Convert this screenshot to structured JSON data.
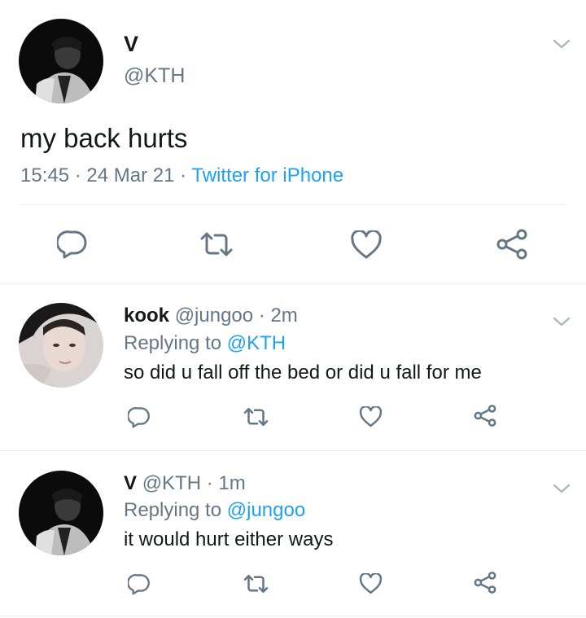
{
  "main_tweet": {
    "name": "V",
    "handle": "@KTH",
    "text": "my back hurts",
    "time": "15:45",
    "sep1": " · ",
    "date": "24 Mar 21",
    "sep2": " · ",
    "source": "Twitter for iPhone"
  },
  "replies": [
    {
      "name": "kook",
      "handle": "@jungoo",
      "time": "· 2m",
      "replying_prefix": "Replying to ",
      "replying_to": "@KTH",
      "text": "so did u fall off the bed or did u fall for me"
    },
    {
      "name": "V",
      "handle": "@KTH",
      "time": "· 1m",
      "replying_prefix": "Replying to ",
      "replying_to": "@jungoo",
      "text": "it would hurt either ways"
    }
  ],
  "icons": {
    "reply": "reply-icon",
    "retweet": "retweet-icon",
    "like": "like-icon",
    "share": "share-icon",
    "menu": "chevron-down-icon"
  },
  "colors": {
    "link": "#1da1f2",
    "secondary": "#657786",
    "icon": "#657786",
    "divider": "#e6ecf0"
  }
}
